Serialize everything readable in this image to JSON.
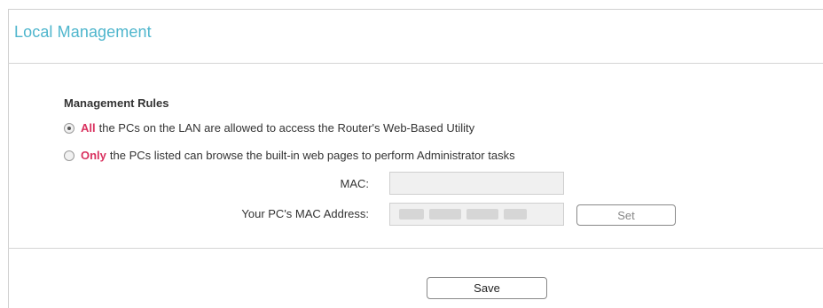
{
  "page": {
    "title": "Local Management"
  },
  "rules": {
    "heading": "Management Rules",
    "options": [
      {
        "keyword": "All",
        "text": "the PCs on the LAN are allowed to access the Router's Web-Based Utility",
        "selected": true
      },
      {
        "keyword": "Only",
        "text": "the PCs listed can browse the built-in web pages to perform Administrator tasks",
        "selected": false
      }
    ]
  },
  "fields": {
    "mac_label": "MAC:",
    "mac_value": "",
    "pc_mac_label": "Your PC's MAC Address:"
  },
  "buttons": {
    "set": "Set",
    "save": "Save"
  },
  "colors": {
    "title": "#4fb6cd",
    "keyword": "#d9315f"
  }
}
